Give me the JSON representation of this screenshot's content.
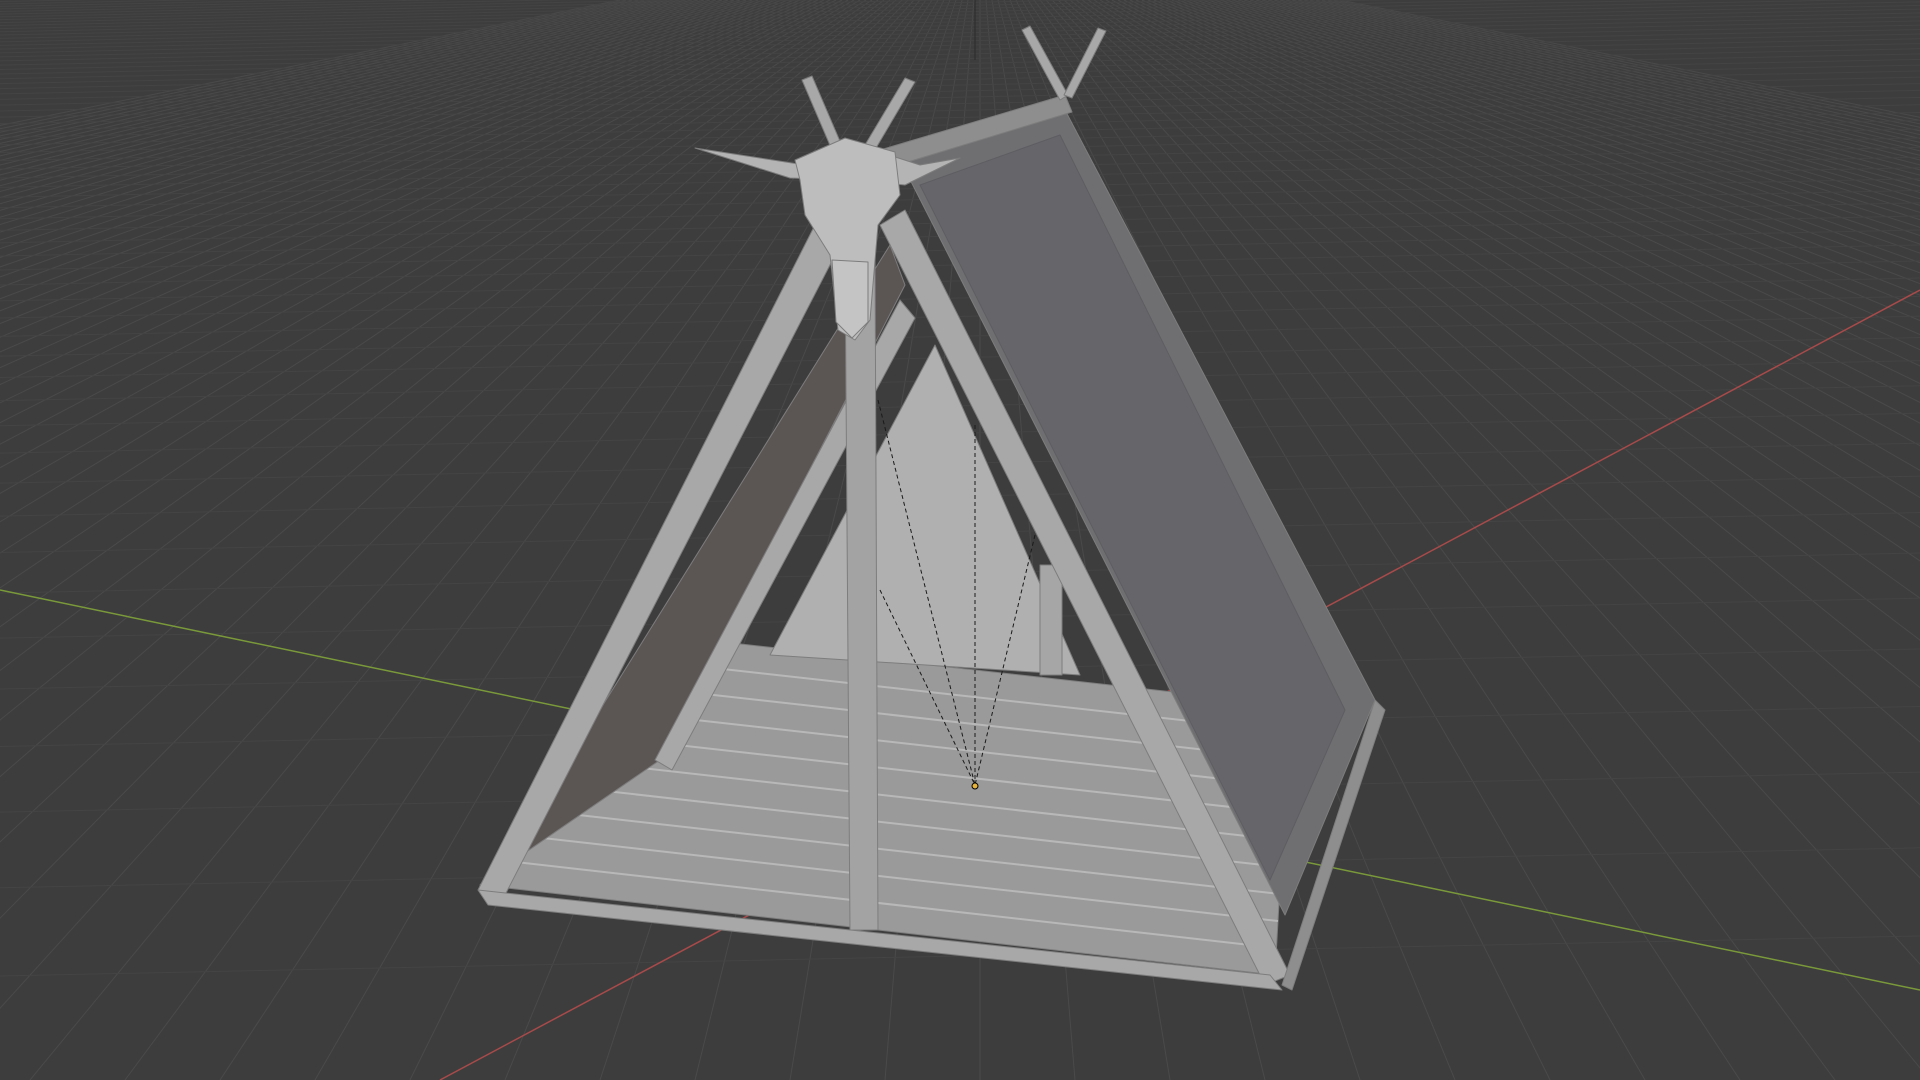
{
  "app": {
    "name": "3D viewport",
    "view": "perspective"
  },
  "colors": {
    "background": "#3d3d3d",
    "grid": "#4a4a4a",
    "grid_minor": "#444444",
    "axis_x": "#a84a4a",
    "axis_y": "#7a9a3a",
    "object_light": "#a8a8a8",
    "object_mid": "#8e8e8e",
    "object_dark": "#6f6f72",
    "object_inner": "#5b5654",
    "floor": "#9a9a9a",
    "origin_point": "#e6b23a"
  },
  "scene": {
    "object": "a-frame-tent",
    "props": [
      "skull-ornament",
      "crossed-ridge-poles",
      "light-empty"
    ]
  }
}
